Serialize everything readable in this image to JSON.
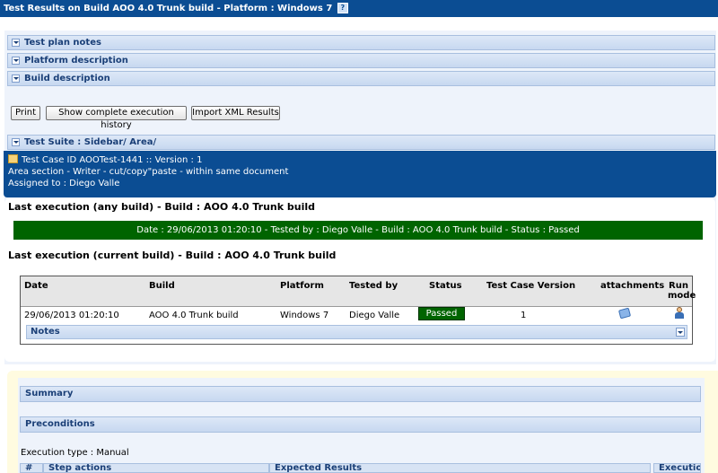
{
  "window": {
    "title": "Test Results on Build AOO 4.0 Trunk build - Platform : Windows 7",
    "help_glyph": "?"
  },
  "panels": {
    "test_plan_notes": "Test plan notes",
    "platform_description": "Platform description",
    "build_description": "Build description"
  },
  "toolbar": {
    "print": "Print",
    "show_history": "Show complete execution history",
    "import_xml": "Import XML Results"
  },
  "test_suite": "Test Suite : Sidebar/ Area/",
  "test_case": {
    "line1": "Test Case ID AOOTest-1441 :: Version : 1",
    "line2": "Area section - Writer - cut/copy\"paste - within same document",
    "line3": "Assigned to : Diego Valle"
  },
  "last_any": {
    "heading": "Last execution (any build) - Build : AOO 4.0 Trunk build",
    "summary": "Date : 29/06/2013 01:20:10 - Tested by : Diego Valle - Build : AOO 4.0 Trunk build - Status : Passed"
  },
  "last_current": {
    "heading": "Last execution (current build) - Build : AOO 4.0 Trunk build"
  },
  "exec_table": {
    "headers": {
      "date": "Date",
      "build": "Build",
      "platform": "Platform",
      "tested_by": "Tested by",
      "status": "Status",
      "tc_version": "Test Case Version",
      "attachments": "attachments",
      "run_mode_1": "Run",
      "run_mode_2": "mode"
    },
    "row": {
      "date": "29/06/2013 01:20:10",
      "build": "AOO 4.0 Trunk build",
      "platform": "Windows 7",
      "tested_by": "Diego Valle",
      "status": "Passed",
      "tc_version": "1"
    },
    "notes": "Notes"
  },
  "lower": {
    "summary": "Summary",
    "preconditions": "Preconditions",
    "execution_type": "Execution type : Manual",
    "step_hash": "#",
    "step_actions": "Step actions",
    "expected_results": "Expected Results",
    "execution": "Execution"
  },
  "colors": {
    "title_bar": "#0b4d93",
    "passed": "#006400",
    "panel_bg": "#eef3fb"
  }
}
